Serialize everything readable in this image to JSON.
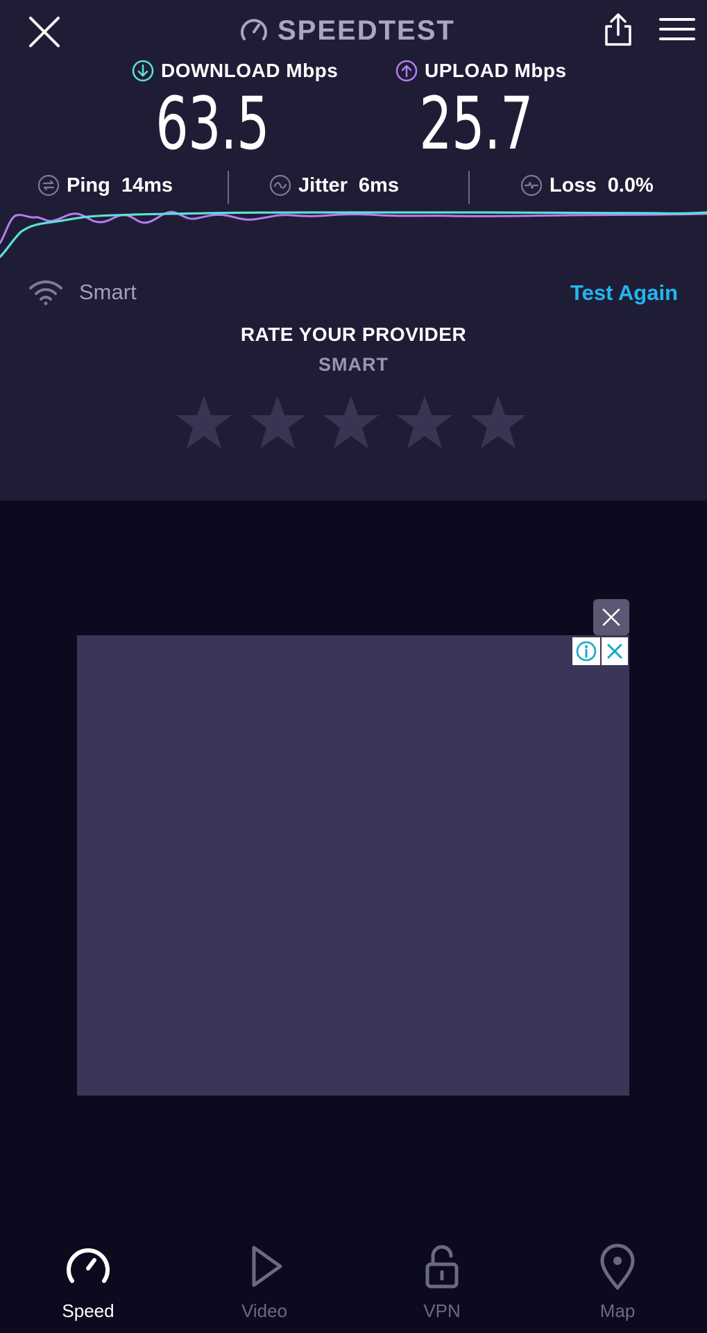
{
  "header": {
    "logo_text": "SPEEDTEST"
  },
  "results": {
    "download_label": "DOWNLOAD Mbps",
    "download_value": "63.5",
    "upload_label": "UPLOAD Mbps",
    "upload_value": "25.7",
    "ping_label": "Ping",
    "ping_value": "14ms",
    "jitter_label": "Jitter",
    "jitter_value": "6ms",
    "loss_label": "Loss",
    "loss_value": "0.0%"
  },
  "network": {
    "name": "Smart",
    "test_again_label": "Test Again"
  },
  "rating": {
    "title": "RATE YOUR PROVIDER",
    "provider": "SMART",
    "stars_total": 5,
    "stars_selected": 0
  },
  "nav": {
    "items": [
      {
        "label": "Speed",
        "icon": "speedometer-icon",
        "active": true
      },
      {
        "label": "Video",
        "icon": "play-icon",
        "active": false
      },
      {
        "label": "VPN",
        "icon": "unlock-icon",
        "active": false
      },
      {
        "label": "Map",
        "icon": "map-pin-icon",
        "active": false
      }
    ]
  },
  "colors": {
    "panel_bg": "#1f1d36",
    "page_bg": "#0b0a1e",
    "download_accent": "#5de0d8",
    "upload_accent": "#b77cf2",
    "link_blue": "#22b6f0",
    "ad_bg": "#3a3657"
  }
}
